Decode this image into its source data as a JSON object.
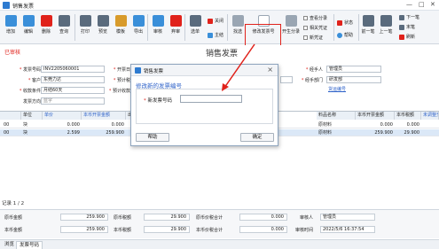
{
  "window": {
    "title": "销售发票",
    "controls": [
      "—",
      "□",
      "✕"
    ]
  },
  "toolbar": {
    "buttons": [
      {
        "label": "增加",
        "icon": "add-icon",
        "color": "#3a8fd9"
      },
      {
        "label": "编辑",
        "icon": "edit-icon",
        "color": "#3a8fd9"
      },
      {
        "label": "删除",
        "icon": "delete-icon",
        "color": "#e0221b"
      },
      {
        "label": "查询",
        "icon": "query-icon",
        "color": "#5a6b7d"
      },
      {
        "label": "打印",
        "icon": "print-icon",
        "color": "#5a6b7d"
      },
      {
        "label": "预览",
        "icon": "preview-icon",
        "color": "#5a6b7d"
      },
      {
        "label": "模板",
        "icon": "template-icon",
        "color": "#d89b2b"
      },
      {
        "label": "导出",
        "icon": "export-icon",
        "color": "#3a8fd9"
      },
      {
        "label": "审核",
        "icon": "audit-icon",
        "color": "#3a8fd9"
      },
      {
        "label": "弃审",
        "icon": "unaudit-icon",
        "color": "#e0221b"
      },
      {
        "label": "选单",
        "icon": "select-order-icon",
        "color": "#5a6b7d"
      },
      {
        "label": "找选",
        "icon": "find-select-icon",
        "color": "#9aa6b3"
      },
      {
        "label": "修改发票号",
        "icon": "edit-invoice-no-icon",
        "color": "#9aa6b3"
      },
      {
        "label": "开生分录",
        "icon": "gen-entry-icon",
        "color": "#9aa6b3"
      },
      {
        "label": "帮助",
        "icon": "help-icon",
        "color": "#3a8fd9"
      },
      {
        "label": "前一笔",
        "icon": "prev-icon",
        "color": "#5a6b7d"
      },
      {
        "label": "上一笔",
        "icon": "up-icon",
        "color": "#5a6b7d"
      }
    ],
    "small": {
      "close_label": "关闭",
      "main_label": "主结",
      "view_entry": "查看分录",
      "ref_cert": "相关凭证",
      "new_cert": "新凭证",
      "status_label": "状态",
      "next_label": "下一笔",
      "last_label": "末笔",
      "refresh_label": "刷新"
    }
  },
  "form": {
    "status": "已审核",
    "doc_title": "销售发票",
    "fields": {
      "invoice_no_label": "发票号码",
      "invoice_no": "INV2205060001",
      "open_date_label": "开票日期",
      "customer_label": "客户",
      "customer": "东莞力达",
      "tax_rate_label": "预计税率",
      "terms_label": "收款条件",
      "terms": "月结60天",
      "est_date_label": "预计收款日",
      "direction_label": "发票方向",
      "direction": "蓝字",
      "handler_label": "经手人",
      "handler": "管理员",
      "dept_label": "经手部门",
      "dept": "研发部",
      "link_label": "货运编号"
    }
  },
  "grid": {
    "headers": [
      "",
      "单位",
      "单价",
      "本币开票金额",
      "出库",
      "料品名称",
      "本币开票金额",
      "本币税额",
      "未调整交"
    ],
    "rows": [
      {
        "no": "00",
        "unit": "块",
        "price": "0.000",
        "amount": "0.000",
        "material": "原材料",
        "amount2": "0.000",
        "tax": "0.000"
      },
      {
        "no": "00",
        "unit": "块",
        "price": "2.599",
        "amount": "259.900",
        "material": "原材料",
        "amount2": "259.900",
        "tax": "29.900"
      }
    ],
    "pager": "记录 1 / 2"
  },
  "footer": {
    "orig_amount_label": "原币金额",
    "orig_amount": "259.900",
    "orig_tax_label": "原币税额",
    "orig_tax": "29.900",
    "orig_total_label": "原币价税合计",
    "orig_total": "0.000",
    "auditor_label": "审核人",
    "auditor": "管理员",
    "local_amount_label": "本币金额",
    "local_amount": "259.900",
    "local_tax_label": "本币税额",
    "local_tax": "29.900",
    "local_total_label": "本币价税合计",
    "local_total": "0.000",
    "audit_time_label": "审核时间",
    "audit_time": "2022/5/6 16:37:54"
  },
  "tabs": [
    "浏览",
    "发票号码"
  ],
  "dialog": {
    "title": "销售发票",
    "heading": "修改新的发票编号",
    "field_label": "新发票号码",
    "field_value": "",
    "help_label": "帮助",
    "ok_label": "确定"
  }
}
